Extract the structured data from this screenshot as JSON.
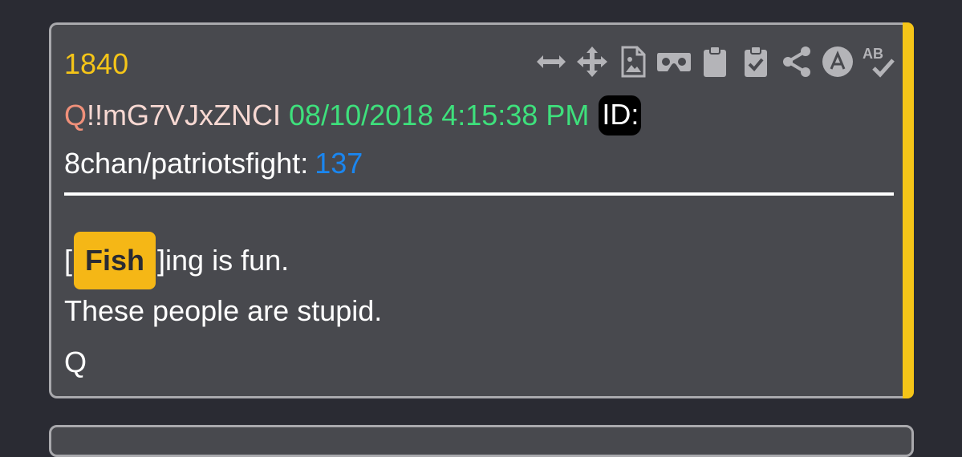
{
  "post": {
    "number": "1840",
    "author_q": "Q",
    "author_trip": "!!mG7VJxZNCI",
    "timestamp": "08/10/2018 4:15:38 PM",
    "id_label": "ID:",
    "board": "8chan/patriotsfight:",
    "post_ref": "137",
    "body": {
      "bracket_open": "[",
      "highlight": "Fish",
      "after_highlight": "]ing is fun.",
      "line2": "These people are stupid.",
      "signature": "Q"
    }
  },
  "toolbar": {
    "icons": [
      "resize-horizontal-icon",
      "move-icon",
      "image-file-icon",
      "vr-headset-icon",
      "clipboard-icon",
      "clipboard-check-icon",
      "share-icon",
      "circle-a-icon",
      "spellcheck-icon"
    ]
  },
  "colors": {
    "accent": "#f5c518",
    "timestamp": "#3ee07c",
    "tripcode": "#f0907a",
    "link": "#1a86f0",
    "card_bg": "#48494e",
    "page_bg": "#2a2b33"
  }
}
